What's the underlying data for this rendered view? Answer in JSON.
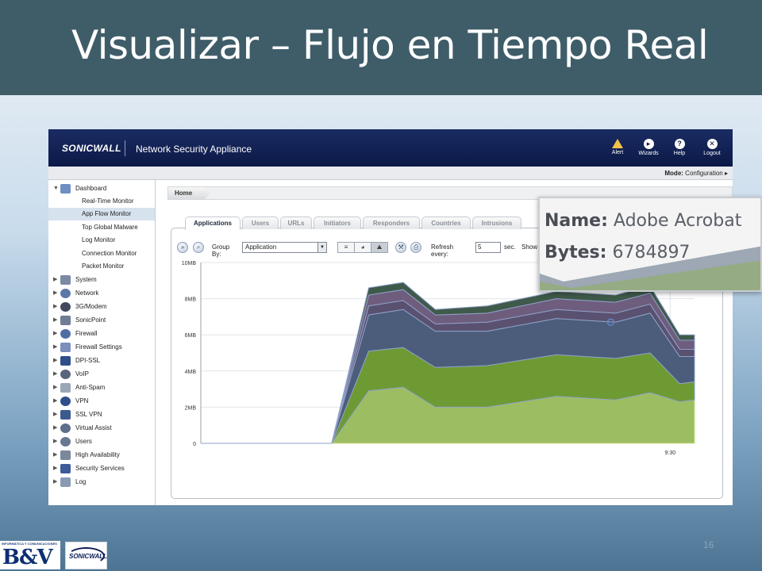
{
  "slide": {
    "title": "Visualizar – Flujo en Tiempo Real",
    "page_number": "16",
    "footer_logo_1_caption": "INFORMÁTICA Y COMUNICACIONES",
    "footer_logo_1_text": "B&V",
    "footer_logo_2_text": "SONICWALL"
  },
  "app": {
    "brand": "SONICWALL",
    "product_name": "Network Security Appliance",
    "top_actions": [
      {
        "label": "Alert",
        "icon": "alert-icon"
      },
      {
        "label": "Wizards",
        "icon": "wizard-icon"
      },
      {
        "label": "Help",
        "icon": "help-icon"
      },
      {
        "label": "Logout",
        "icon": "logout-icon"
      }
    ],
    "mode_label": "Mode:",
    "mode_value": "Configuration ▸",
    "breadcrumb_home": "Home"
  },
  "sidebar": {
    "dashboard": "Dashboard",
    "dashboard_items": [
      "Real-Time Monitor",
      "App Flow Monitor",
      "Top Global Malware",
      "Log Monitor",
      "Connection Monitor",
      "Packet Monitor"
    ],
    "active_item": "App Flow Monitor",
    "sections": [
      "System",
      "Network",
      "3G/Modem",
      "SonicPoint",
      "Firewall",
      "Firewall Settings",
      "DPI-SSL",
      "VoIP",
      "Anti-Spam",
      "VPN",
      "SSL VPN",
      "Virtual Assist",
      "Users",
      "High Availability",
      "Security Services",
      "Log"
    ]
  },
  "tabs": [
    "Applications",
    "Users",
    "URLs",
    "Initiators",
    "Responders",
    "Countries",
    "Intrusions"
  ],
  "active_tab": "Applications",
  "toolbar": {
    "group_by_label": "Group By:",
    "group_by_value": "Application",
    "refresh_label": "Refresh every:",
    "refresh_value": "5",
    "sec_label": "sec.",
    "show_label": "Show"
  },
  "tooltip": {
    "name_label": "Name:",
    "name_value": "Adobe Acrobat",
    "bytes_label": "Bytes:",
    "bytes_value": "6784897"
  },
  "chart_data": {
    "type": "area",
    "stacked": true,
    "yticks": [
      "0",
      "2MB",
      "4MB",
      "6MB",
      "8MB",
      "10MB"
    ],
    "ylim": [
      0,
      10
    ],
    "xtick_labels": [
      "9:30"
    ],
    "x": [
      0,
      1,
      2,
      3,
      4,
      5,
      6,
      7,
      8,
      9,
      10,
      11
    ],
    "series": [
      {
        "color": "#9cbd62",
        "values": [
          0,
          0,
          0,
          2.9,
          3.1,
          2.0,
          2.0,
          2.6,
          2.4,
          2.8,
          2.3,
          2.4
        ]
      },
      {
        "color": "#6e9a34",
        "values": [
          0,
          0,
          0,
          2.2,
          2.2,
          2.2,
          2.3,
          2.3,
          2.3,
          2.2,
          1.0,
          1.0
        ]
      },
      {
        "color": "#4b5d7a",
        "values": [
          0,
          0,
          0,
          2.0,
          2.1,
          2.0,
          1.9,
          2.0,
          2.0,
          2.2,
          1.5,
          1.4
        ]
      },
      {
        "color": "#5a5170",
        "values": [
          0,
          0,
          0,
          0.5,
          0.5,
          0.4,
          0.5,
          0.5,
          0.5,
          0.5,
          0.4,
          0.4
        ]
      },
      {
        "color": "#6e5d7d",
        "values": [
          0,
          0,
          0,
          0.6,
          0.6,
          0.5,
          0.5,
          0.6,
          0.6,
          0.6,
          0.5,
          0.5
        ]
      },
      {
        "color": "#3f5a4a",
        "values": [
          0,
          0,
          0,
          0.4,
          0.4,
          0.3,
          0.4,
          0.4,
          0.4,
          0.4,
          0.3,
          0.3
        ]
      }
    ],
    "grid": true
  }
}
